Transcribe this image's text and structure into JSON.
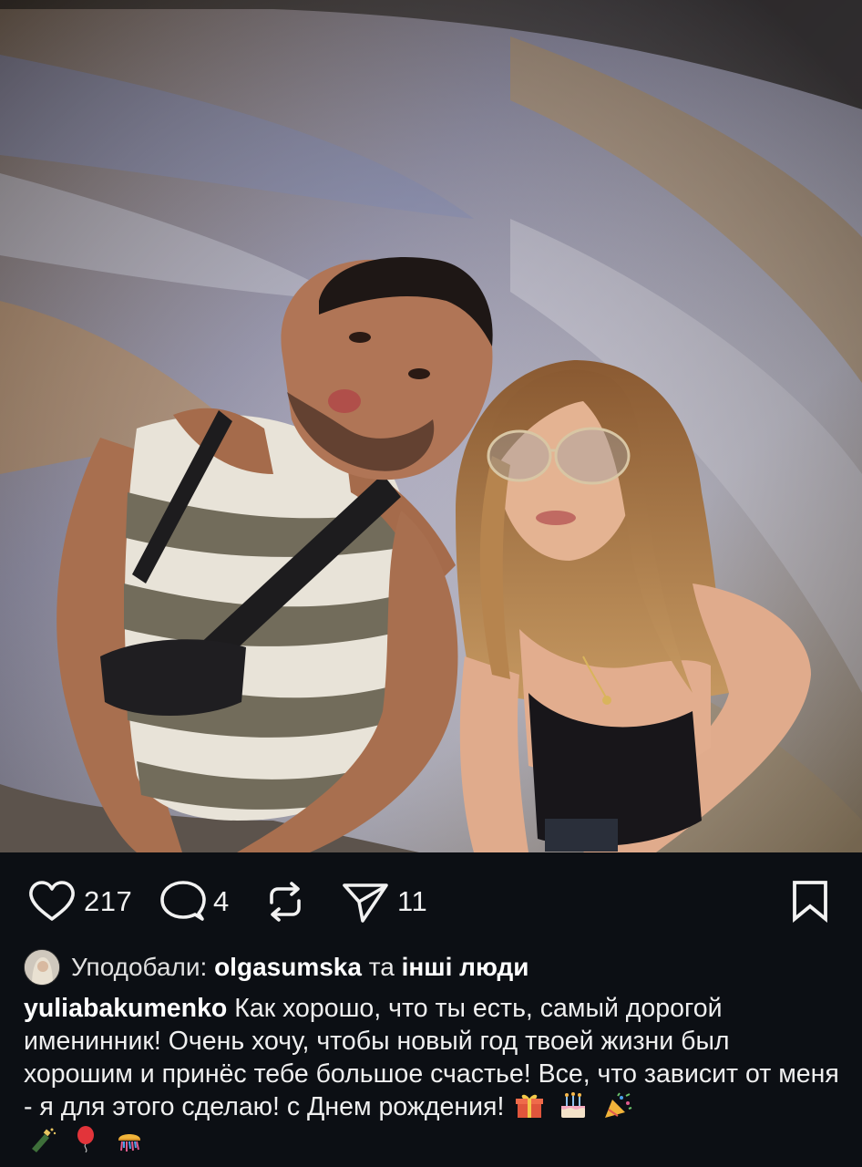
{
  "actions": {
    "likes_count": "217",
    "comments_count": "4",
    "shares_count": "11"
  },
  "liked_by": {
    "prefix": "Уподобали:",
    "user": "olgasumska",
    "conj": "та",
    "others": "інші люди"
  },
  "caption": {
    "username": "yuliabakumenko",
    "text": "Как хорошо, что ты есть, самый дорогой именинник! Очень хочу, чтобы новый год твоей жизни был хорошим и принёс тебе большое счастье! Все, что зависит от меня - я для этого сделаю! с Днем рождения!",
    "emojis": [
      "gift",
      "birthday-cake",
      "party-popper",
      "champagne",
      "balloon",
      "confetti-ball"
    ]
  },
  "colors": {
    "background": "#0c0f14",
    "text": "#f5f5f5"
  }
}
